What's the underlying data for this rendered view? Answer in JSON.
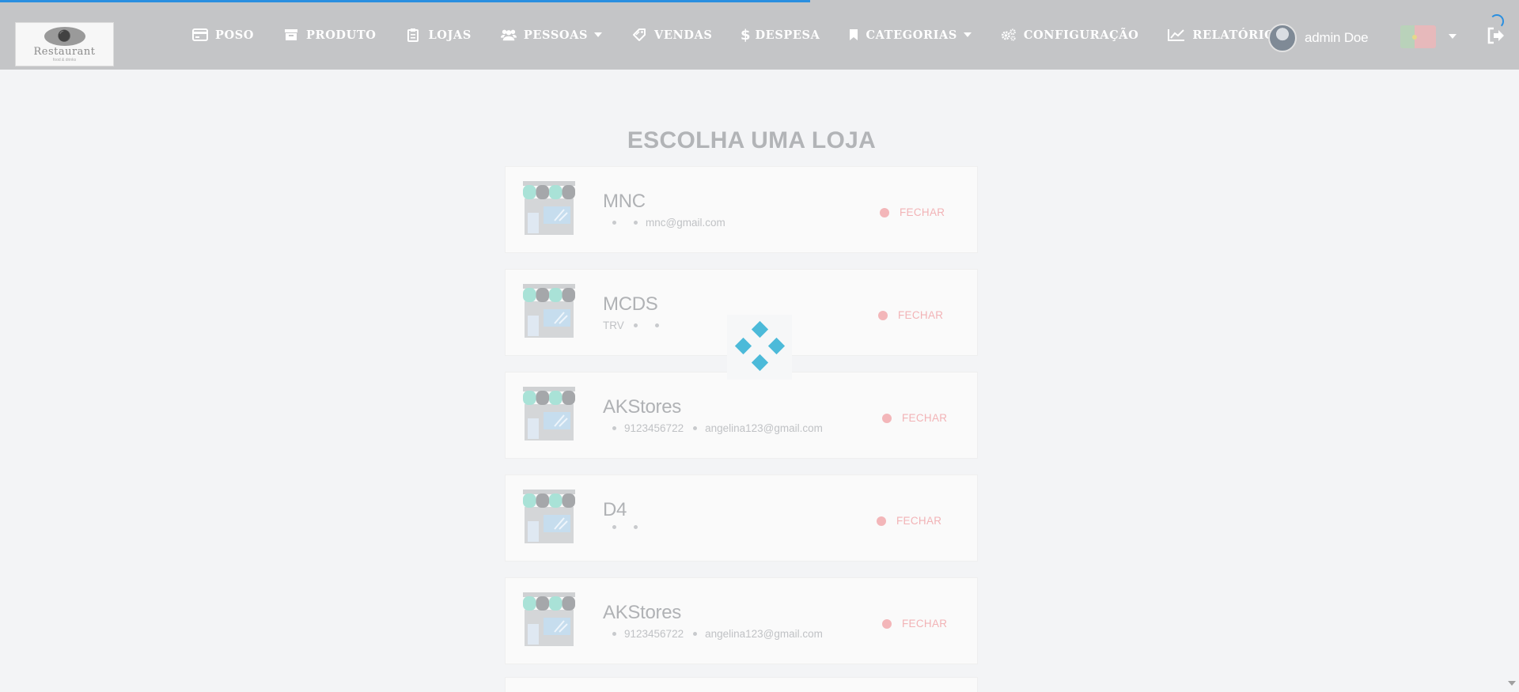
{
  "app": {
    "logo_text": "Restaurant",
    "logo_tagline": "food & drinks"
  },
  "nav": [
    {
      "label": "POSO",
      "icon": "credit-card-icon"
    },
    {
      "label": "PRODUTO",
      "icon": "archive-box-icon"
    },
    {
      "label": "LOJAS",
      "icon": "clipboard-icon"
    },
    {
      "label": "PESSOAS",
      "icon": "users-icon",
      "dropdown": true
    },
    {
      "label": "VENDAS",
      "icon": "tag-icon"
    },
    {
      "label": "DESPESA",
      "icon": "dollar-icon"
    },
    {
      "label": "CATEGORIAS",
      "icon": "bookmark-icon",
      "dropdown": true
    },
    {
      "label": "CONFIGURAÇÃO",
      "icon": "gears-icon"
    },
    {
      "label": "RELATÓRIOS",
      "icon": "line-chart-icon"
    }
  ],
  "user": {
    "name": "admin Doe"
  },
  "language_flag": "portugal-flag-icon",
  "main": {
    "title": "ESCOLHA UMA LOJA",
    "stores": [
      {
        "name": "MNC",
        "prefix": "",
        "phone": "",
        "email": "mnc@gmail.com",
        "status": "FECHAR"
      },
      {
        "name": "MCDS",
        "prefix": "TRV",
        "phone": "",
        "email": "",
        "status": "FECHAR"
      },
      {
        "name": "AKStores",
        "prefix": "",
        "phone": "9123456722",
        "email": "angelina123@gmail.com",
        "status": "FECHAR"
      },
      {
        "name": "D4",
        "prefix": "",
        "phone": "",
        "email": "",
        "status": "FECHAR"
      },
      {
        "name": "AKStores",
        "prefix": "",
        "phone": "9123456722",
        "email": "angelina123@gmail.com",
        "status": "FECHAR"
      }
    ]
  },
  "colors": {
    "header_bg": "#c4c5c7",
    "page_bg": "#f3f4f6",
    "status_closed": "#f2b3b6",
    "loader": "#4cbad9",
    "progress": "#2a8fe0"
  }
}
